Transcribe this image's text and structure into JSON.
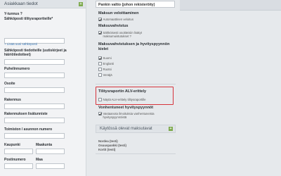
{
  "left_panel": {
    "title": "Asiakkaan tiedot",
    "fields": {
      "ytunnus": "Y-tunnus ?",
      "email": "Sähköposti tilitysraportteille*",
      "add_email_link": "+ Lisää uusi sähköposti",
      "info_email": "Sähköposti tiedotteille (uutiskirjeet ja häiriötiedotteet)",
      "phone": "Puhelinnumero",
      "address": "Osoite",
      "building": "Rakennus",
      "building_extra": "Rakennuksen lisätunniste",
      "office": "Toimiston / asunnon numero",
      "city": "Kaupunki",
      "county": "Maakunta",
      "postal": "Postinumero",
      "country": "Maa"
    }
  },
  "middle_panel": {
    "bank_country_value": "Pankin valtio (johon rekisteröity)",
    "payment_collection": {
      "title": "Maksun veloittaminen",
      "auto_collect": "Automaattinen veloitus"
    },
    "payment_reminder": {
      "title": "Maksuvahvistus",
      "send_reminder": "Sähköisesti osoitteisiin lisätyt maksumuistutukset ?"
    },
    "language": {
      "title": "Maksuvahvistuksen ja hyvityspyynnön kielet",
      "options": [
        {
          "label": "Suomi",
          "checked": true
        },
        {
          "label": "Englanti",
          "checked": false
        },
        {
          "label": "Ruotsi",
          "checked": false
        },
        {
          "label": "Venäjä",
          "checked": false
        }
      ]
    },
    "vat_report": {
      "title": "Tilitysraportin ALV-erittely",
      "show_vat": "Näytä ALV-erittely tilitysraportille",
      "show_vat_checked": false
    },
    "refund": {
      "title": "Vonhentuneet hyvityspyynnöt",
      "note": "Vastaanota ilmoituksia vanhentuneista hyvityspyynnöistä",
      "checked": true
    },
    "methods_panel": {
      "title": "Käytössä olevat maksutavat",
      "persons": [
        "Nordea (testi)",
        "Osuuspankki (testi)",
        "Kortit (testi)"
      ]
    }
  },
  "colors": {
    "accent_green": "#7eaa4e",
    "highlight_red": "#d6333b",
    "link_blue": "#3a78b5"
  }
}
